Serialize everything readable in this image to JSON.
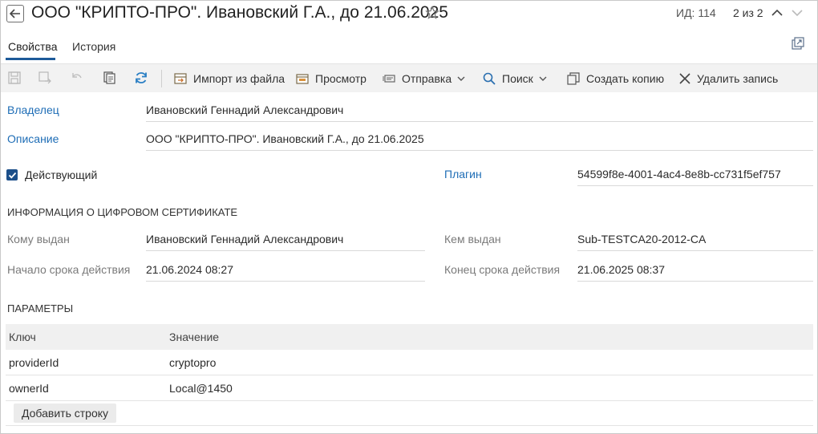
{
  "header": {
    "title": "ООО \"КРИПТО-ПРО\". Ивановский Г.А., до 21.06.2025",
    "record_id": "ИД: 114",
    "record_position": "2 из 2"
  },
  "tabs": [
    {
      "label": "Свойства",
      "active": true
    },
    {
      "label": "История",
      "active": false
    }
  ],
  "toolbar": {
    "import_label": "Импорт из файла",
    "preview_label": "Просмотр",
    "send_label": "Отправка",
    "search_label": "Поиск",
    "copy_label": "Создать копию",
    "delete_label": "Удалить запись"
  },
  "form": {
    "owner_label": "Владелец",
    "owner_value": "Ивановский Геннадий Александрович",
    "description_label": "Описание",
    "description_value": "ООО \"КРИПТО-ПРО\". Ивановский Г.А., до 21.06.2025",
    "active_label": "Действующий",
    "active_checked": true,
    "plugin_label": "Плагин",
    "plugin_value": "54599f8e-4001-4ac4-8e8b-cc731f5ef757"
  },
  "certificate": {
    "section_title": "ИНФОРМАЦИЯ О ЦИФРОВОМ СЕРТИФИКАТЕ",
    "issued_to_label": "Кому выдан",
    "issued_to_value": "Ивановский Геннадий Александрович",
    "issued_by_label": "Кем выдан",
    "issued_by_value": "Sub-TESTCA20-2012-CA",
    "valid_from_label": "Начало срока действия",
    "valid_from_value": "21.06.2024 08:27",
    "valid_to_label": "Конец срока действия",
    "valid_to_value": "21.06.2025 08:37"
  },
  "params": {
    "section_title": "ПАРАМЕТРЫ",
    "columns": [
      "Ключ",
      "Значение"
    ],
    "rows": [
      [
        "providerId",
        "cryptopro"
      ],
      [
        "ownerId",
        "Local@1450"
      ]
    ],
    "add_row_label": "Добавить строку"
  },
  "colors": {
    "accent": "#1d5a99",
    "link": "#1e6db6",
    "toolbar_bg": "#f2f2f2",
    "refresh_icon": "#2a7fc4"
  },
  "icons": [
    "arrow-left-icon",
    "star-icon",
    "chevron-up-icon",
    "chevron-down-icon",
    "open-external-icon",
    "save-icon",
    "save-close-icon",
    "undo-icon",
    "copy-doc-icon",
    "refresh-icon",
    "import-icon",
    "preview-icon",
    "send-icon",
    "search-icon",
    "duplicate-icon",
    "close-icon",
    "checkmark-icon"
  ]
}
